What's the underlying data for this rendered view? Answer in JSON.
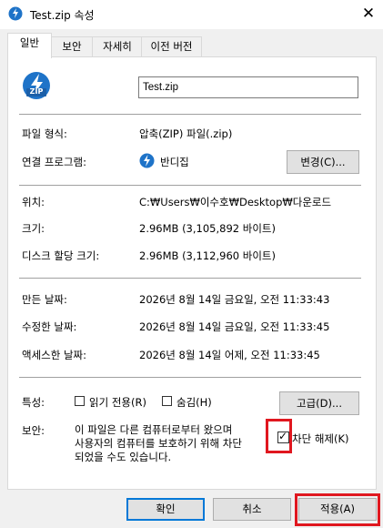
{
  "window": {
    "title": "Test.zip 속성",
    "close_glyph": "✕"
  },
  "tabs": [
    {
      "label": "일반",
      "active": true
    },
    {
      "label": "보안",
      "active": false
    },
    {
      "label": "자세히",
      "active": false
    },
    {
      "label": "이전 버전",
      "active": false
    }
  ],
  "icons": {
    "zip_icon_text": "ZIP"
  },
  "file": {
    "name": "Test.zip",
    "type_label": "파일 형식:",
    "type_value": "압축(ZIP) 파일(.zip)",
    "opens_label": "연결 프로그램:",
    "opens_value": "반디집",
    "change_button": "변경(C)...",
    "location_label": "위치:",
    "location_value": "C:₩Users₩이수호₩Desktop₩다운로드",
    "size_label": "크기:",
    "size_value": "2.96MB (3,105,892 바이트)",
    "disk_label": "디스크 할당 크기:",
    "disk_value": "2.96MB (3,112,960 바이트)",
    "created_label": "만든 날짜:",
    "created_value": "2026년 8월 14일 금요일, 오전 11:33:43",
    "modified_label": "수정한 날짜:",
    "modified_value": "2026년 8월 14일 금요일, 오전 11:33:45",
    "accessed_label": "액세스한 날짜:",
    "accessed_value": "2026년 8월 14일 어제, 오전 11:33:45"
  },
  "attributes": {
    "label": "특성:",
    "readonly_label": "읽기 전용(R)",
    "readonly_checked": false,
    "hidden_label": "숨김(H)",
    "hidden_checked": false,
    "advanced_button": "고급(D)..."
  },
  "security": {
    "label": "보안:",
    "line1": "이 파일은 다른 컴퓨터로부터 왔으며",
    "line2": "사용자의 컴퓨터를 보호하기 위해 차단",
    "line3": "되었을 수도 있습니다.",
    "unblock_label": "차단 해제(K)",
    "unblock_checked": true,
    "check_glyph": "✓"
  },
  "footer": {
    "ok": "확인",
    "cancel": "취소",
    "apply": "적용(A)"
  },
  "colors": {
    "highlight": "#e0171f",
    "zip_icon": "#1e73c8",
    "primary_border": "#0078d7"
  }
}
